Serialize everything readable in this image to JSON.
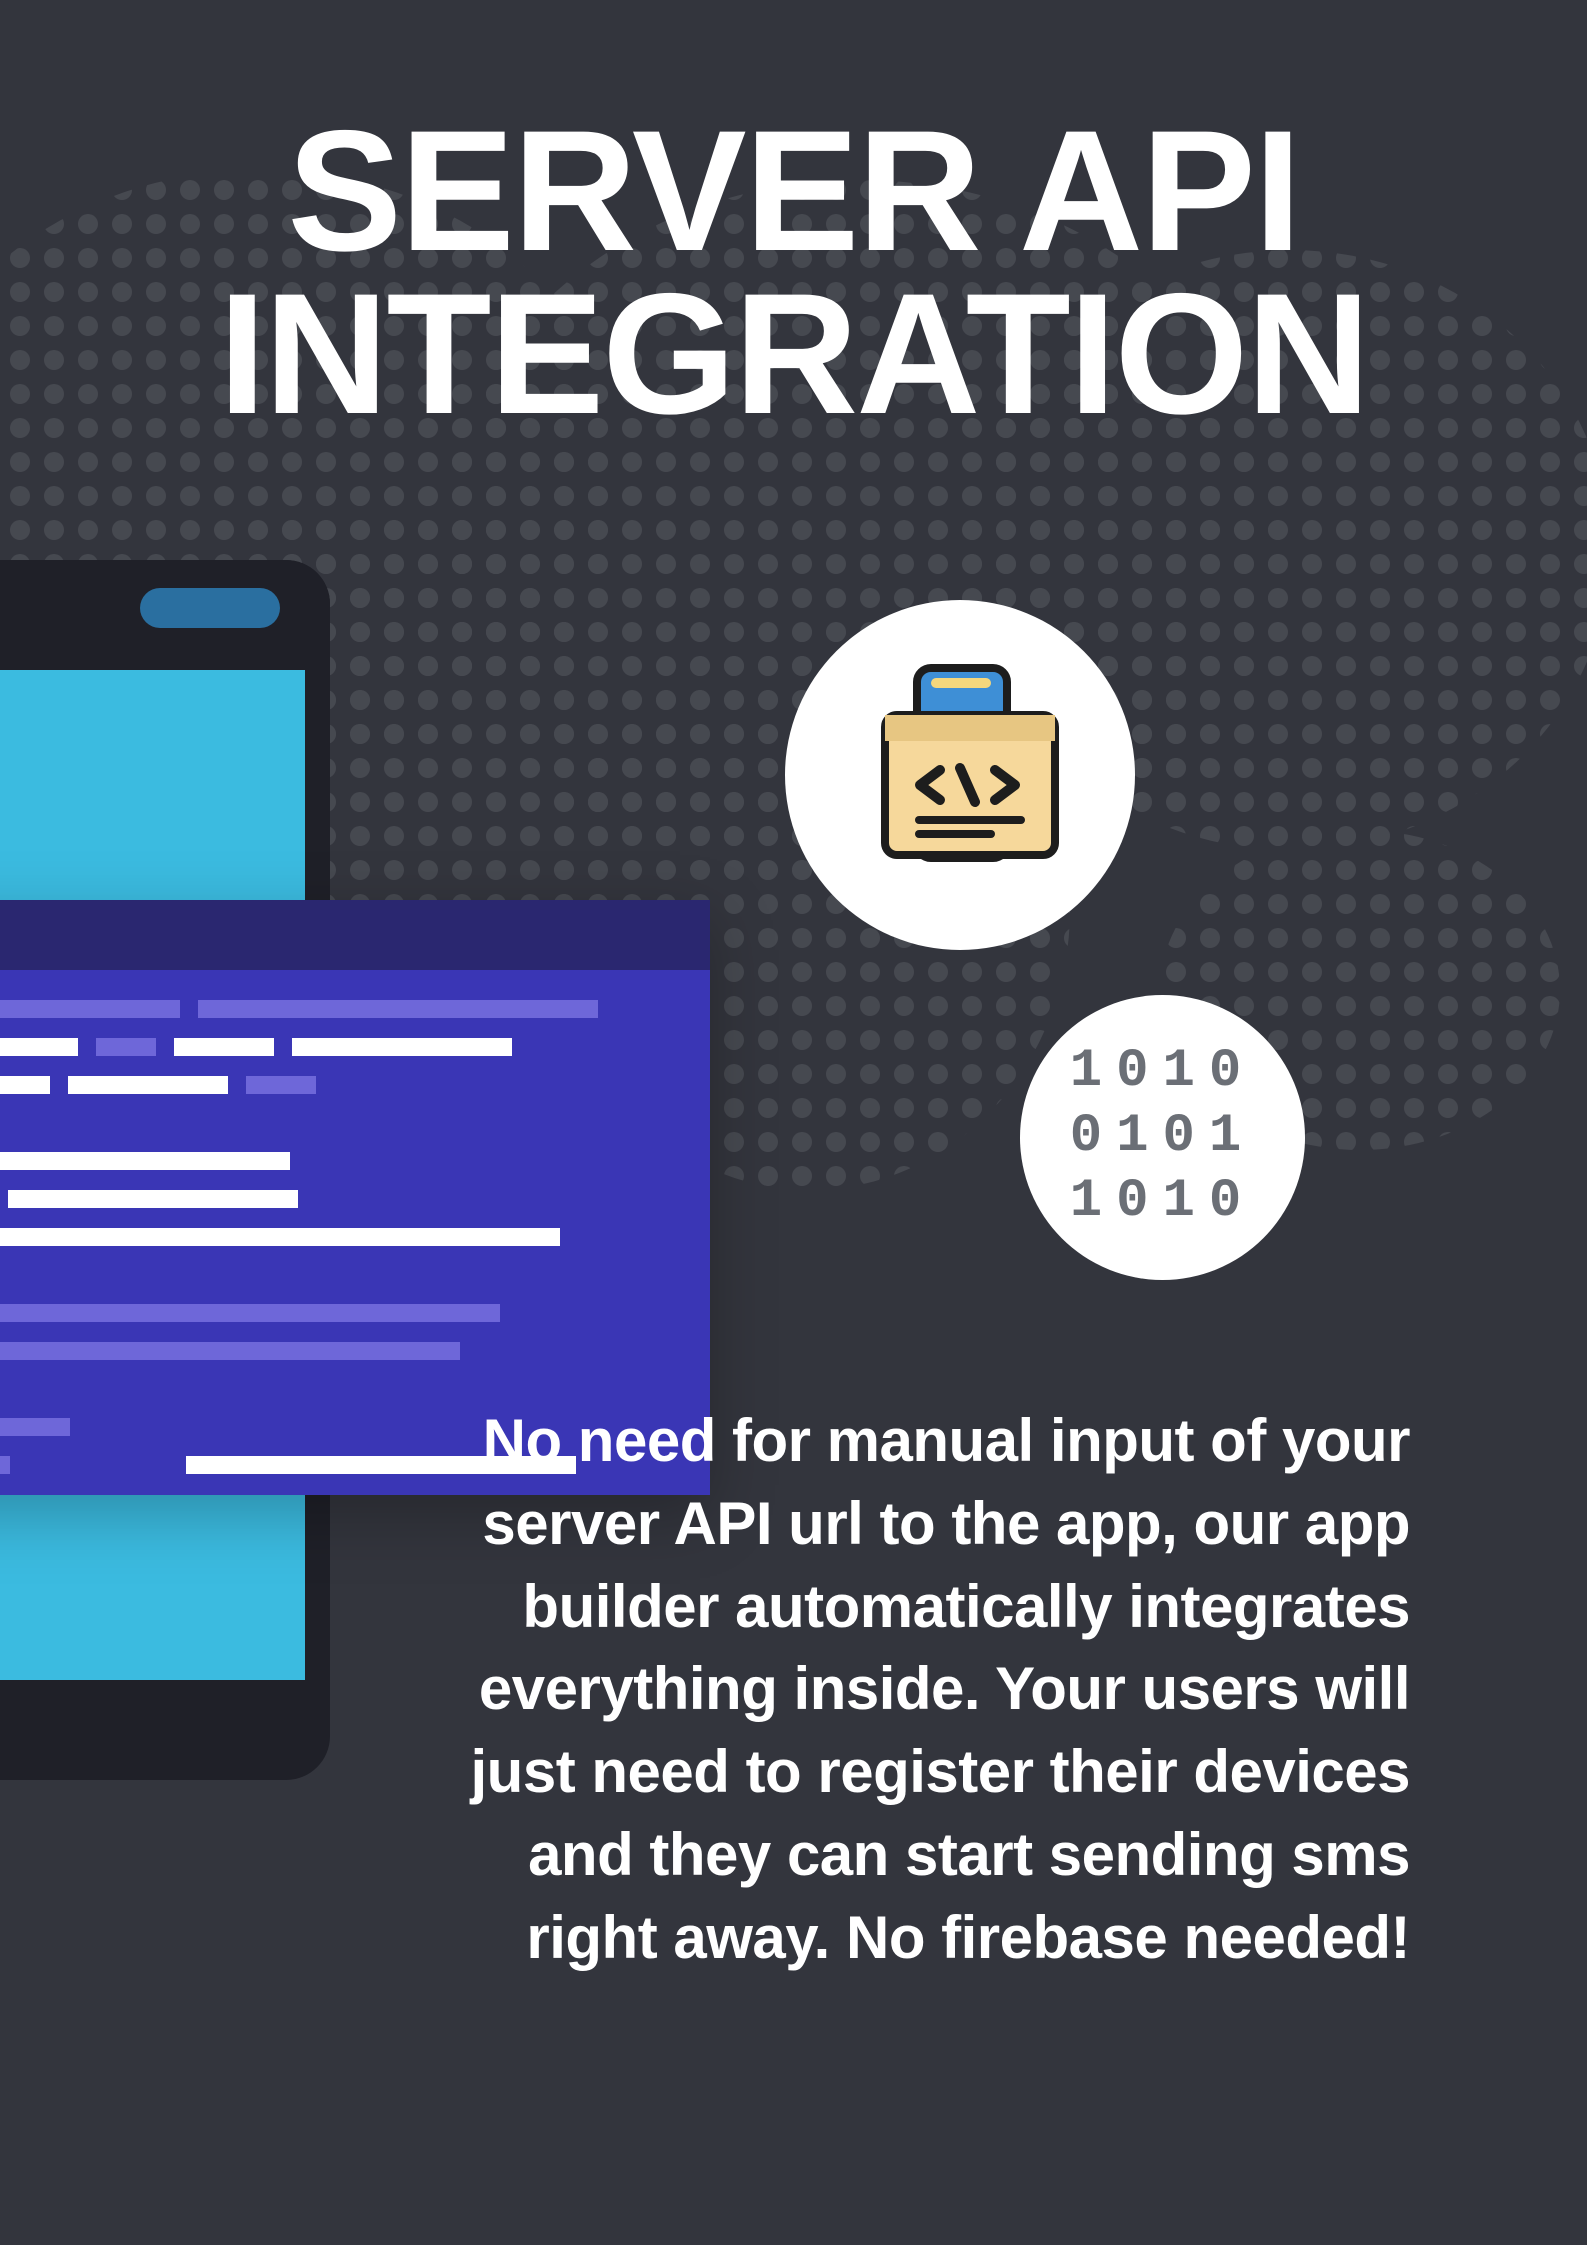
{
  "title_line1": "SERVER API",
  "title_line2": "INTEGRATION",
  "body": "No need for manual input of your server API url to the app, our app builder automatically integrates everything inside. Your users will just need to register their devices and they can start sending sms right away. No firebase needed!",
  "binary_line1": "1010",
  "binary_line2": "0101",
  "binary_line3": "1010",
  "colors": {
    "background": "#33353d",
    "accent_blue": "#3bbbe0",
    "code_window": "#3a36b5",
    "code_titlebar": "#2a2770"
  }
}
